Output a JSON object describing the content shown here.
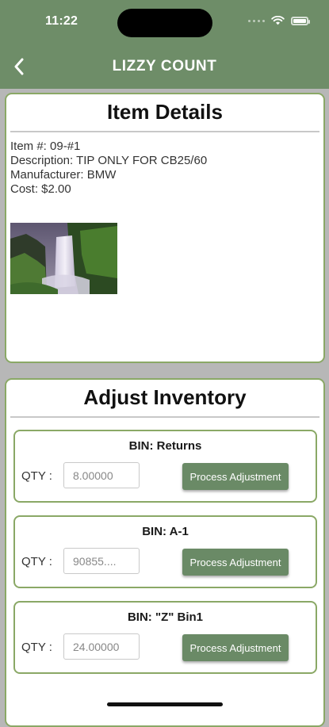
{
  "status_bar": {
    "time": "11:22"
  },
  "header": {
    "title": "LIZZY COUNT",
    "back_icon": "chevron-left-icon"
  },
  "item_details": {
    "title": "Item Details",
    "item_number": "Item #: 09-#1",
    "description": "Description: TIP ONLY FOR CB25/60",
    "manufacturer": "Manufacturer: BMW",
    "cost": "Cost: $2.00",
    "image_icon": "waterfall-photo"
  },
  "adjust_inventory": {
    "title": "Adjust Inventory",
    "bins": [
      {
        "bin_label": "BIN: Returns",
        "qty_label": "QTY :",
        "qty_value": "8.00000",
        "button_label": "Process Adjustment"
      },
      {
        "bin_label": "BIN: A-1",
        "qty_label": "QTY :",
        "qty_value": "90855....",
        "button_label": "Process Adjustment"
      },
      {
        "bin_label": "BIN: \"Z\" Bin1",
        "qty_label": "QTY :",
        "qty_value": "24.00000",
        "button_label": "Process Adjustment"
      }
    ]
  },
  "colors": {
    "header": "#6e8d68",
    "border_accent": "#8aa866",
    "button": "#6a8a66",
    "page_background": "#b7b7b7"
  },
  "battery_level": 1.0
}
